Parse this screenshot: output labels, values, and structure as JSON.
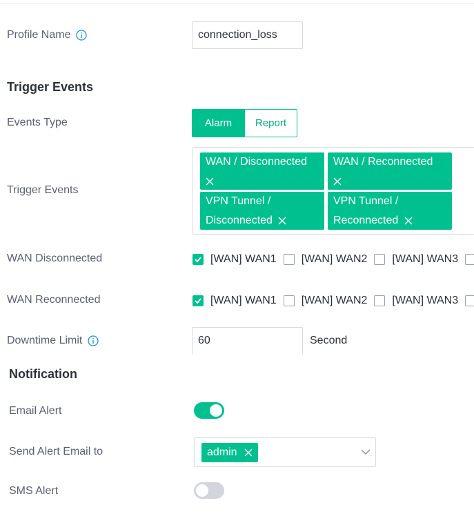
{
  "form": {
    "profile_name": {
      "label": "Profile Name",
      "value": "connection_loss"
    },
    "trigger_events_section": "Trigger Events",
    "events_type": {
      "label": "Events Type",
      "options": [
        "Alarm",
        "Report"
      ],
      "selected": "Alarm"
    },
    "trigger_events": {
      "label": "Trigger Events",
      "tags": [
        {
          "line1": "WAN / Disconnected"
        },
        {
          "line1": "WAN / Reconnected"
        },
        {
          "line1": "VPN Tunnel /",
          "line2": "Disconnected"
        },
        {
          "line1": "VPN Tunnel /",
          "line2": "Reconnected"
        }
      ]
    },
    "wan_disconnected": {
      "label": "WAN Disconnected",
      "options": [
        {
          "label": "[WAN] WAN1",
          "checked": true
        },
        {
          "label": "[WAN] WAN2",
          "checked": false
        },
        {
          "label": "[WAN] WAN3",
          "checked": false
        }
      ]
    },
    "wan_reconnected": {
      "label": "WAN Reconnected",
      "options": [
        {
          "label": "[WAN] WAN1",
          "checked": true
        },
        {
          "label": "[WAN] WAN2",
          "checked": false
        },
        {
          "label": "[WAN] WAN3",
          "checked": false
        }
      ]
    },
    "downtime_limit": {
      "label": "Downtime Limit",
      "value": "60",
      "unit": "Second"
    }
  },
  "notification": {
    "title": "Notification",
    "email_alert": {
      "label": "Email Alert",
      "enabled": true
    },
    "send_alert_email_to": {
      "label": "Send Alert Email to",
      "tags": [
        "admin"
      ]
    },
    "sms_alert": {
      "label": "SMS Alert",
      "enabled": false
    }
  },
  "colors": {
    "accent": "#00c08f",
    "info_icon": "#1e90d6",
    "border": "#d7dbe1"
  }
}
